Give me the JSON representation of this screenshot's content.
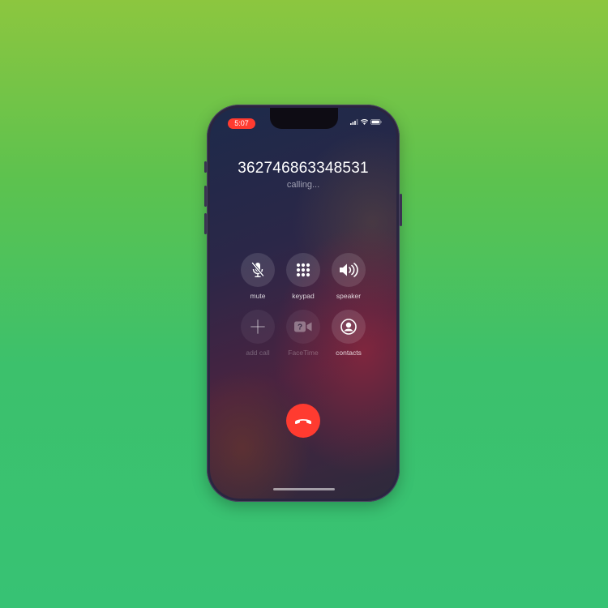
{
  "status_bar": {
    "time": "5:07",
    "icons": [
      "signal-icon",
      "wifi-icon",
      "battery-icon"
    ]
  },
  "call": {
    "number": "362746863348531",
    "status": "calling..."
  },
  "controls": [
    {
      "id": "mute",
      "label": "mute",
      "icon": "mic-slash-icon",
      "enabled": true
    },
    {
      "id": "keypad",
      "label": "keypad",
      "icon": "keypad-icon",
      "enabled": true
    },
    {
      "id": "speaker",
      "label": "speaker",
      "icon": "speaker-icon",
      "enabled": true
    },
    {
      "id": "add-call",
      "label": "add call",
      "icon": "plus-icon",
      "enabled": false
    },
    {
      "id": "facetime",
      "label": "FaceTime",
      "icon": "facetime-icon",
      "enabled": false
    },
    {
      "id": "contacts",
      "label": "contacts",
      "icon": "contacts-icon",
      "enabled": true
    }
  ],
  "end_call": {
    "icon": "end-call-icon",
    "color": "#ff3b30"
  },
  "colors": {
    "accent_red": "#ff3b30",
    "background_top": "#8cc63f",
    "background_bottom": "#37c274"
  }
}
